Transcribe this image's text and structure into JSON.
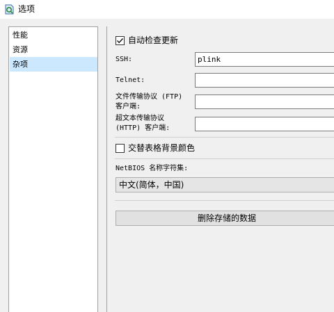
{
  "window": {
    "title": "选项"
  },
  "nav": {
    "items": [
      {
        "label": "性能"
      },
      {
        "label": "资源"
      },
      {
        "label": "杂项",
        "selected": true
      }
    ]
  },
  "misc": {
    "auto_update_label": "自动检查更新",
    "auto_update_checked": true,
    "ssh_label": "SSH:",
    "ssh_value": "plink",
    "telnet_label": "Telnet:",
    "telnet_value": "",
    "ftp_label_line1": "文件传输协议 (FTP)",
    "ftp_label_line2": "客户端:",
    "ftp_value": "",
    "http_label_line1": "超文本传输协议",
    "http_label_line2": "(HTTP) 客户端:",
    "http_value": "",
    "alt_row_color_label": "交替表格背景颜色",
    "alt_row_color_checked": false,
    "netbios_label": "NetBIOS 名称字符集:",
    "netbios_value": "中文(简体，中国)",
    "delete_data_button": "删除存储的数据"
  },
  "colors": {
    "selection": "#cce8ff",
    "window_bg": "#f0f0f0"
  }
}
